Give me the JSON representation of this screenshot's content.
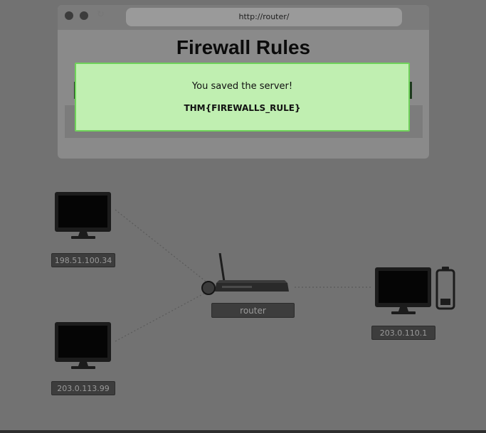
{
  "browser": {
    "url": "http://router/",
    "page_title": "Firewall Rules",
    "icons": [
      "close-dot-icon",
      "minimize-dot-icon",
      "refresh-icon"
    ]
  },
  "alert": {
    "message": "You saved the server!",
    "flag": "THM{FIREWALLS_RULE}",
    "colors": {
      "background": "#c0efb1",
      "border": "#6fd25a"
    }
  },
  "network": {
    "hosts": [
      {
        "id": "host-top-left",
        "ip": "198.51.100.34"
      },
      {
        "id": "host-bottom-left",
        "ip": "203.0.113.99"
      },
      {
        "id": "host-right",
        "ip": "203.0.110.1",
        "battery_icon": "battery-low-icon"
      }
    ],
    "router": {
      "label": "router"
    }
  },
  "colors": {
    "overlay": "#727272"
  }
}
